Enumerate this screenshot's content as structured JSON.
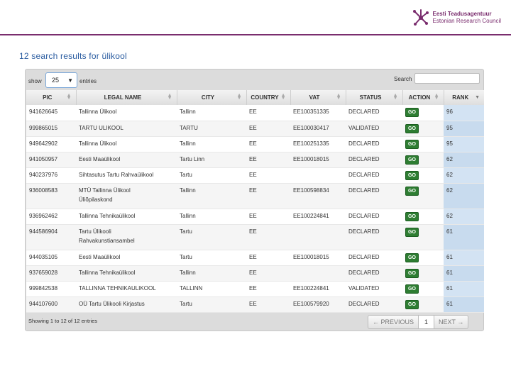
{
  "brand": {
    "line1": "Eesti Teadusagentuur",
    "line2": "Estonian Research Council"
  },
  "page_title": "12 search results for ülikool",
  "controls": {
    "show_label": "show",
    "page_size": "25",
    "entries_label": "entries",
    "search_label": "Search",
    "search_value": ""
  },
  "columns": [
    "PIC",
    "LEGAL NAME",
    "CITY",
    "COUNTRY",
    "VAT",
    "STATUS",
    "ACTION",
    "RANK"
  ],
  "rows": [
    {
      "pic": "941626645",
      "name": "Tallinna Ülikool",
      "name2": "",
      "city": "Tallinn",
      "country": "EE",
      "vat": "EE100351335",
      "status": "DECLARED",
      "action": "GO",
      "rank": "96"
    },
    {
      "pic": "999865015",
      "name": "TARTU ULIKOOL",
      "name2": "",
      "city": "TARTU",
      "country": "EE",
      "vat": "EE100030417",
      "status": "VALIDATED",
      "action": "GO",
      "rank": "95"
    },
    {
      "pic": "949642902",
      "name": "Tallinna Ülikool",
      "name2": "",
      "city": "Tallinn",
      "country": "EE",
      "vat": "EE100251335",
      "status": "DECLARED",
      "action": "GO",
      "rank": "95"
    },
    {
      "pic": "941050957",
      "name": "Eesti Maaülikool",
      "name2": "",
      "city": "Tartu Linn",
      "country": "EE",
      "vat": "EE100018015",
      "status": "DECLARED",
      "action": "GO",
      "rank": "62"
    },
    {
      "pic": "940237976",
      "name": "Sihtasutus Tartu Rahvaülikool",
      "name2": "",
      "city": "Tartu",
      "country": "EE",
      "vat": "",
      "status": "DECLARED",
      "action": "GO",
      "rank": "62"
    },
    {
      "pic": "936008583",
      "name": "MTÜ Tallinna Ülikool",
      "name2": "Üliõpilaskond",
      "city": "Tallinn",
      "country": "EE",
      "vat": "EE100598834",
      "status": "DECLARED",
      "action": "GO",
      "rank": "62"
    },
    {
      "pic": "936962462",
      "name": "Tallinna Tehnikaülikool",
      "name2": "",
      "city": "Tallinn",
      "country": "EE",
      "vat": "EE100224841",
      "status": "DECLARED",
      "action": "GO",
      "rank": "62"
    },
    {
      "pic": "944586904",
      "name": "Tartu Ülikooli",
      "name2": "Rahvakunstiansambel",
      "city": "Tartu",
      "country": "EE",
      "vat": "",
      "status": "DECLARED",
      "action": "GO",
      "rank": "61"
    },
    {
      "pic": "944035105",
      "name": "Eesti Maaülikool",
      "name2": "",
      "city": "Tartu",
      "country": "EE",
      "vat": "EE100018015",
      "status": "DECLARED",
      "action": "GO",
      "rank": "61"
    },
    {
      "pic": "937659028",
      "name": "Tallinna Tehnikaülikool",
      "name2": "",
      "city": "Tallinn",
      "country": "EE",
      "vat": "",
      "status": "DECLARED",
      "action": "GO",
      "rank": "61"
    },
    {
      "pic": "999842538",
      "name": "TALLINNA TEHNIKAULIKOOL",
      "name2": "",
      "city": "TALLINN",
      "country": "EE",
      "vat": "EE100224841",
      "status": "VALIDATED",
      "action": "GO",
      "rank": "61"
    },
    {
      "pic": "944107600",
      "name": "OÜ Tartu Ülikooli Kirjastus",
      "name2": "",
      "city": "Tartu",
      "country": "EE",
      "vat": "EE100579920",
      "status": "DECLARED",
      "action": "GO",
      "rank": "61"
    }
  ],
  "footer": {
    "info": "Showing 1 to 12 of 12 entries",
    "prev_label": "← PREVIOUS",
    "current_page": "1",
    "next_label": "NEXT →"
  },
  "colors": {
    "accent": "#7a2d6e",
    "link": "#2a5ca0",
    "go_button": "#2e7d32",
    "rank_column": "#d3e3f3"
  }
}
